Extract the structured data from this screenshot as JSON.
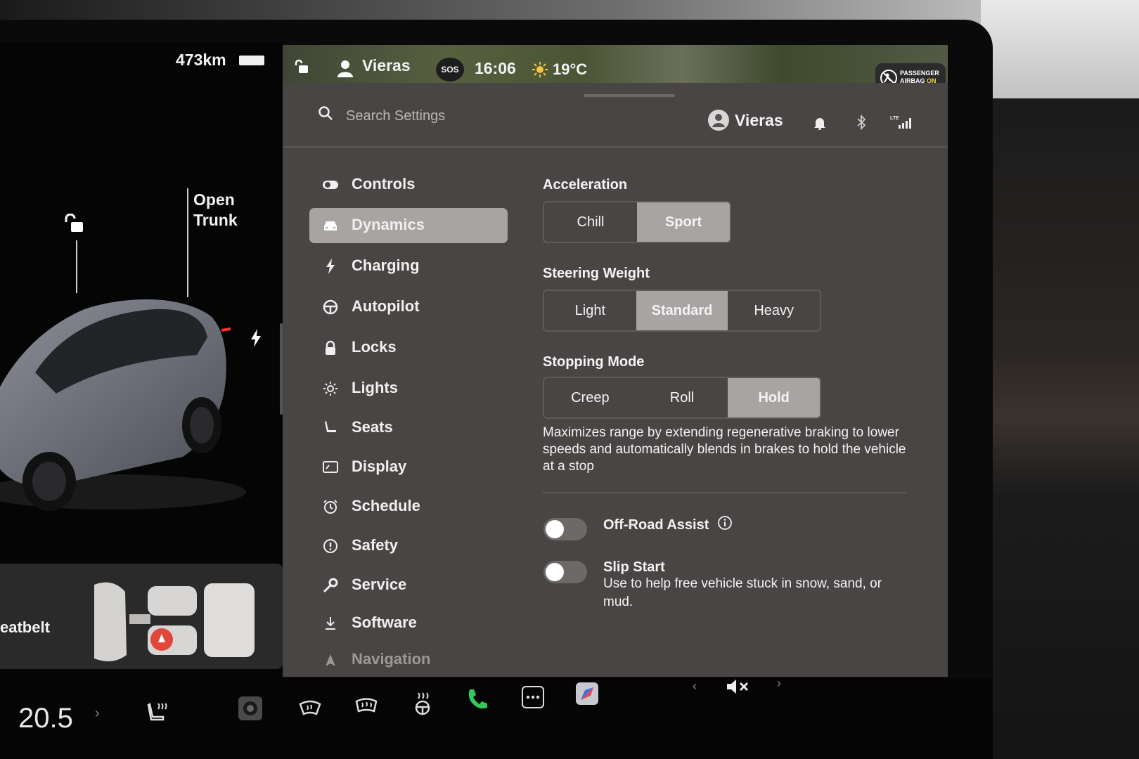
{
  "status": {
    "range": "473km"
  },
  "car": {
    "trunk_label_line1": "Open",
    "trunk_label_line2": "Trunk",
    "seatbelt_label": "eatbelt"
  },
  "topbar": {
    "user": "Vieras",
    "sos": "SOS",
    "time": "16:06",
    "temperature": "19°C",
    "airbag_line1": "PASSENGER",
    "airbag_line2": "AIRBAG",
    "airbag_state": "ON"
  },
  "header": {
    "search_placeholder": "Search Settings",
    "user": "Vieras",
    "lte": "LTE"
  },
  "nav": {
    "items": [
      {
        "label": "Controls",
        "icon": "toggle-icon"
      },
      {
        "label": "Dynamics",
        "icon": "car-icon",
        "active": true
      },
      {
        "label": "Charging",
        "icon": "bolt-icon"
      },
      {
        "label": "Autopilot",
        "icon": "steering-wheel-icon"
      },
      {
        "label": "Locks",
        "icon": "lock-icon"
      },
      {
        "label": "Lights",
        "icon": "sun-icon"
      },
      {
        "label": "Seats",
        "icon": "seat-icon"
      },
      {
        "label": "Display",
        "icon": "display-icon"
      },
      {
        "label": "Schedule",
        "icon": "alarm-clock-icon"
      },
      {
        "label": "Safety",
        "icon": "alert-icon"
      },
      {
        "label": "Service",
        "icon": "wrench-icon"
      },
      {
        "label": "Software",
        "icon": "download-icon"
      },
      {
        "label": "Navigation",
        "icon": "navigation-icon"
      }
    ]
  },
  "dynamics": {
    "acceleration": {
      "title": "Acceleration",
      "options": [
        "Chill",
        "Sport"
      ],
      "selected": "Sport"
    },
    "steering": {
      "title": "Steering Weight",
      "options": [
        "Light",
        "Standard",
        "Heavy"
      ],
      "selected": "Standard"
    },
    "stopping": {
      "title": "Stopping Mode",
      "options": [
        "Creep",
        "Roll",
        "Hold"
      ],
      "selected": "Hold",
      "description": "Maximizes range by extending regenerative braking to lower speeds and automatically blends in brakes to hold the vehicle at a stop"
    },
    "offroad": {
      "label": "Off-Road Assist",
      "on": false
    },
    "slipstart": {
      "label": "Slip Start",
      "description": "Use to help free vehicle stuck in snow, sand, or mud.",
      "on": false
    }
  },
  "dock": {
    "temperature": "20.5",
    "temp_chevron": "›",
    "prev": "‹",
    "next": "›"
  },
  "colors": {
    "panel": "#494545",
    "active": "#a8a4a3",
    "phone": "#34c759",
    "seat_alert": "#e0483c"
  }
}
